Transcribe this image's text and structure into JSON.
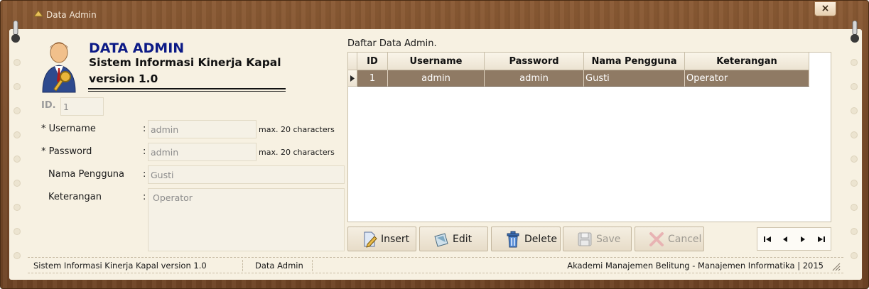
{
  "window": {
    "title": "Data Admin",
    "close_label": "×"
  },
  "header": {
    "title": "DATA ADMIN",
    "subtitle": "Sistem Informasi Kinerja Kapal",
    "version": "version 1.0"
  },
  "form": {
    "id_label": "ID.",
    "id_value": "1",
    "username_label": "* Username",
    "username_value": "admin",
    "username_hint": "max. 20 characters",
    "password_label": "* Password",
    "password_value": "admin",
    "password_hint": "max. 20 characters",
    "nama_label": "Nama Pengguna",
    "nama_value": "Gusti",
    "keterangan_label": "Keterangan",
    "keterangan_value": "Operator",
    "colon": ":"
  },
  "grid": {
    "caption": "Daftar Data Admin.",
    "columns": [
      "ID",
      "Username",
      "Password",
      "Nama Pengguna",
      "Keterangan"
    ],
    "rows": [
      [
        "1",
        "admin",
        "admin",
        "Gusti",
        "Operator"
      ]
    ]
  },
  "toolbar": {
    "insert": "Insert",
    "edit": "Edit",
    "delete": "Delete",
    "save": "Save",
    "cancel": "Cancel"
  },
  "navigator": {
    "first": "first-record-icon",
    "prev": "previous-record-icon",
    "next": "next-record-icon",
    "last": "last-record-icon"
  },
  "status": {
    "app": "Sistem Informasi Kinerja Kapal version 1.0",
    "module": "Data Admin",
    "credit": "Akademi Manajemen Belitung - Manajemen Informatika | 2015"
  },
  "colors": {
    "title_blue": "#0c1a86",
    "selected_row": "#8f7a64",
    "paper": "#f7f1e2",
    "wood": "#7a4c2a"
  }
}
